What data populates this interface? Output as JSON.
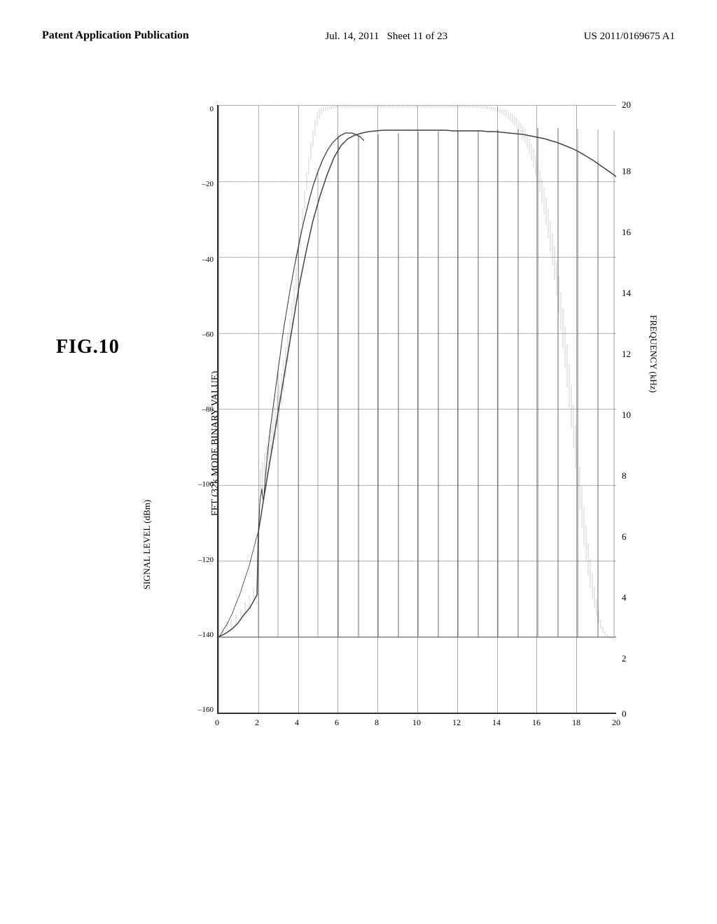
{
  "header": {
    "left_line1": "Patent Application Publication",
    "date": "Jul. 14, 2011",
    "sheet": "Sheet 11 of 23",
    "patent_number": "US 2011/0169675 A1"
  },
  "figure": {
    "label": "FIG.10"
  },
  "chart": {
    "fft_label": "FFT (32k MODE BINARY VALUE)",
    "x_axis_label": "FREQUENCY (kHz)",
    "y_axis_label": "SIGNAL LEVEL (dBm)",
    "x_ticks": [
      "0",
      "2",
      "4",
      "6",
      "8",
      "10",
      "12",
      "14",
      "16",
      "18",
      "20"
    ],
    "y_ticks": [
      "0",
      "-20",
      "-40",
      "-60",
      "-80",
      "-100",
      "-120",
      "-140",
      "-160"
    ],
    "right_numbers": [
      "20",
      "18",
      "16",
      "14",
      "12",
      "10",
      "8",
      "6",
      "4",
      "2",
      "0"
    ]
  }
}
